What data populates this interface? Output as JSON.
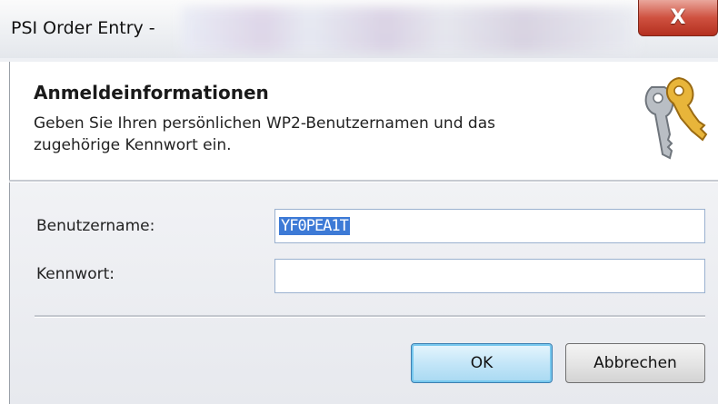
{
  "window": {
    "title": "PSI Order Entry -",
    "close_glyph": "X"
  },
  "header": {
    "title": "Anmeldeinformationen",
    "description": "Geben Sie Ihren persönlichen WP2-Benutzernamen und das zugehörige Kennwort ein.",
    "icon": "keys-icon"
  },
  "form": {
    "username_label": "Benutzername:",
    "username_value": "YF0PEA1T",
    "password_label": "Kennwort:",
    "password_value": ""
  },
  "buttons": {
    "ok": "OK",
    "cancel": "Abbrechen"
  },
  "colors": {
    "selection": "#3d7ad6",
    "close_button": "#cf5140",
    "ok_button_border": "#3c7fb1",
    "key_gold": "#e8b53a",
    "key_gray": "#9aa0a6"
  }
}
